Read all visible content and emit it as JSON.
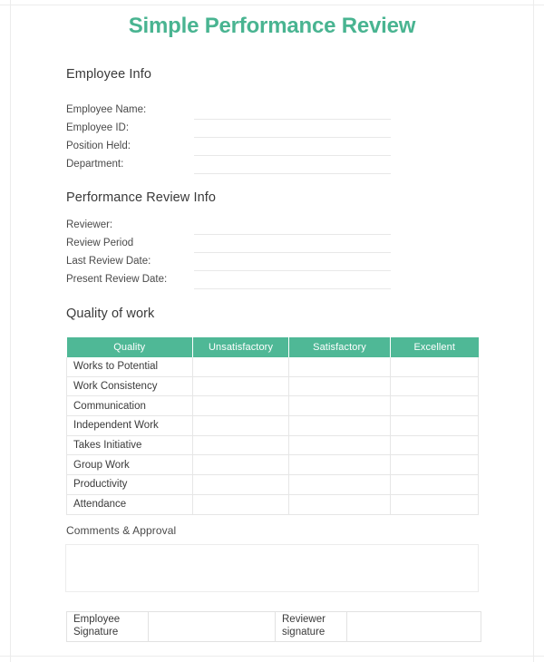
{
  "document": {
    "title": "Simple Performance Review",
    "accent_color": "#4fb896",
    "title_color": "#49b491",
    "rule_color": "#e8e8e8"
  },
  "employee_info": {
    "heading": "Employee Info",
    "fields": [
      {
        "label": "Employee Name:",
        "value": ""
      },
      {
        "label": "Employee ID:",
        "value": ""
      },
      {
        "label": "Position Held:",
        "value": ""
      },
      {
        "label": "Department:",
        "value": ""
      }
    ]
  },
  "review_info": {
    "heading": "Performance Review Info",
    "fields": [
      {
        "label": "Reviewer:",
        "value": ""
      },
      {
        "label": "Review Period",
        "value": ""
      },
      {
        "label": "Last Review Date:",
        "value": ""
      },
      {
        "label": "Present Review Date:",
        "value": ""
      }
    ]
  },
  "quality_of_work": {
    "heading": "Quality of work",
    "columns": [
      "Quality",
      "Unsatisfactory",
      "Satisfactory",
      "Excellent"
    ],
    "rows": [
      "Works to Potential",
      "Work Consistency",
      "Communication",
      "Independent Work",
      "Takes Initiative",
      "Group Work",
      "Productivity",
      "Attendance"
    ]
  },
  "comments": {
    "heading": "Comments & Approval",
    "value": ""
  },
  "signatures": {
    "employee_label": "Employee Signature",
    "employee_value": "",
    "reviewer_label": "Reviewer signature",
    "reviewer_value": ""
  }
}
